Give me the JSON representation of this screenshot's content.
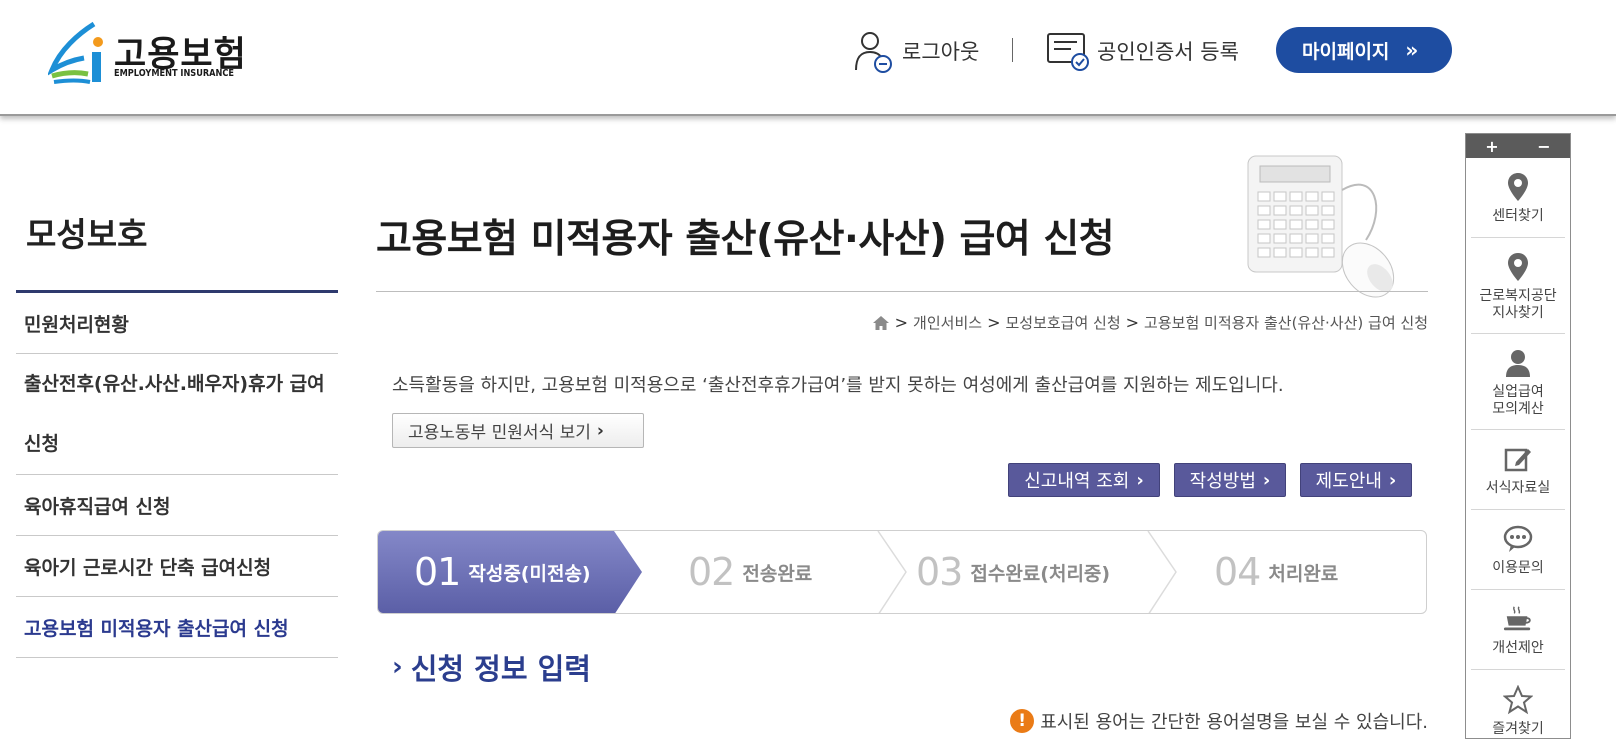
{
  "header": {
    "logo_text": "고용보험",
    "logo_subtext": "EMPLOYMENT INSURANCE",
    "logout_label": "로그아웃",
    "cert_label": "공인인증서 등록",
    "mypage_label": "마이페이지",
    "mypage_chevron": "»"
  },
  "sidebar": {
    "title": "모성보호",
    "items": [
      {
        "label": "민원처리현황"
      },
      {
        "label": "출산전후(유산.사산.배우자)휴가 급여 신청"
      },
      {
        "label": "육아휴직급여 신청"
      },
      {
        "label": "육아기 근로시간 단축 급여신청"
      },
      {
        "label": "고용보험 미적용자 출산급여 신청"
      }
    ]
  },
  "main": {
    "title": "고용보험 미적용자 출산(유산·사산) 급여 신청",
    "breadcrumb": [
      "개인서비스",
      "모성보호급여 신청",
      "고용보험 미적용자 출산(유산·사산) 급여 신청"
    ],
    "breadcrumb_sep": ">",
    "description": "소득활동을 하지만, 고용보험 미적용으로 ‘출산전후휴가급여’를 받지 못하는 여성에게 출산급여를 지원하는 제도입니다.",
    "form_button": "고용노동부 민원서식 보기",
    "chevron": "›",
    "action_buttons": {
      "history": "신고내역 조회",
      "howto": "작성방법",
      "guide": "제도안내"
    },
    "steps": [
      {
        "num": "01",
        "label": "작성중(미전송)"
      },
      {
        "num": "02",
        "label": "전송완료"
      },
      {
        "num": "03",
        "label": "접수완료(처리중)"
      },
      {
        "num": "04",
        "label": "처리완료"
      }
    ],
    "section_arrow": "›",
    "section_title": "신청 정보 입력",
    "notice_icon": "!",
    "notice": "표시된 용어는 간단한 용어설명을 보실 수 있습니다."
  },
  "quick_menu": {
    "zoom_in": "+",
    "zoom_out": "−",
    "items": [
      {
        "label": "센터찾기",
        "icon": "pin-icon"
      },
      {
        "label": "근로복지공단 지사찾기",
        "icon": "pin-icon"
      },
      {
        "label": "실업급여 모의계산",
        "icon": "person-icon"
      },
      {
        "label": "서식자료실",
        "icon": "edit-icon"
      },
      {
        "label": "이용문의",
        "icon": "chat-icon"
      },
      {
        "label": "개선제안",
        "icon": "coffee-icon"
      },
      {
        "label": "즐겨찾기",
        "icon": "star-icon"
      }
    ]
  },
  "colors": {
    "brand_blue": "#1e4da1",
    "nav_active": "#2b3a8f",
    "button_purple": "#59599b",
    "step_active": "#6b6fb4",
    "notice_orange": "#ea7b16"
  }
}
